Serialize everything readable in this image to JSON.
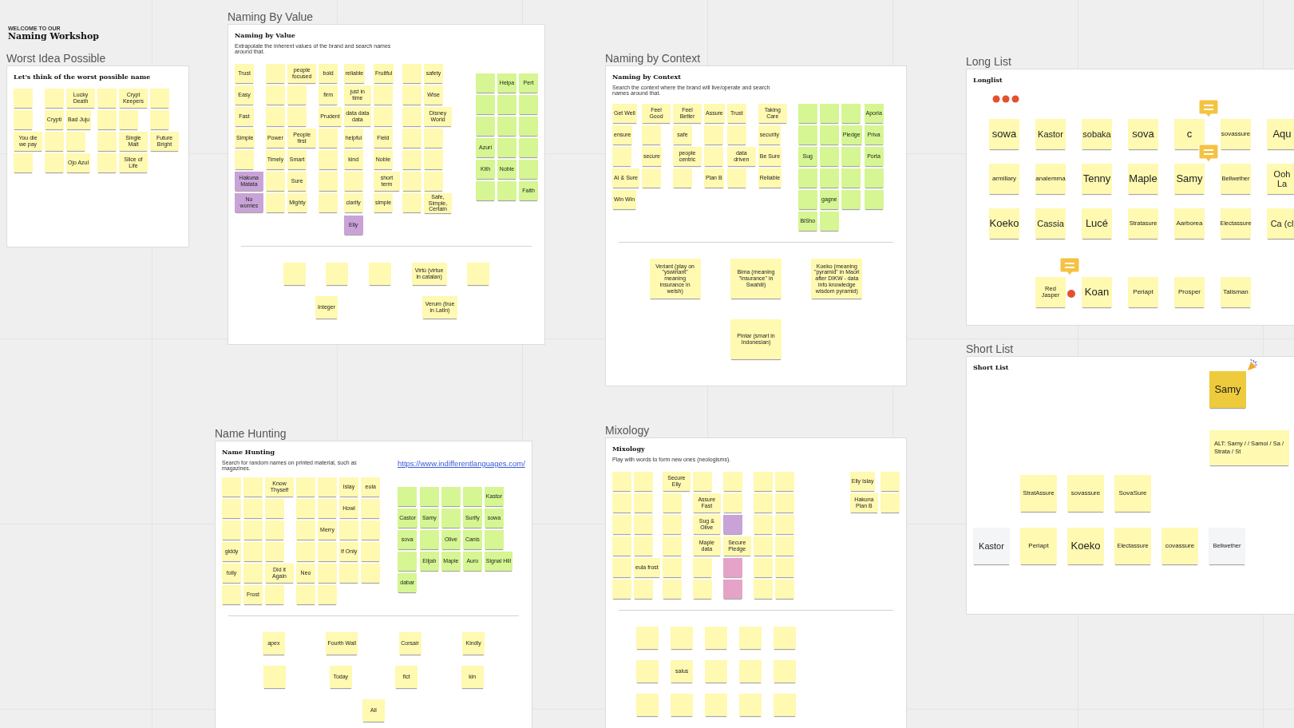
{
  "header": {
    "kicker": "WELCOME TO OUR",
    "title": "Naming Workshop"
  },
  "frames": [
    {
      "kind": "workshop",
      "label": "Worst Idea Possible",
      "heading": "Let's think of the worst possible name",
      "clusters": [
        {
          "notes": [
            {
              "color": "#fff9b1"
            },
            {
              "color": "#fff9b1"
            },
            {
              "text": "Lucky Death",
              "color": "#fff9b1"
            },
            {
              "color": "#fff9b1"
            },
            {
              "text": "Crypt Keepers",
              "color": "#fff9b1"
            },
            {
              "color": "#fff9b1"
            },
            {
              "color": "#fff9b1"
            },
            {
              "text": "Crypti",
              "color": "#fff9b1"
            },
            {
              "text": "Bad Juju",
              "color": "#fff9b1"
            },
            {
              "color": "#fff9b1"
            },
            {
              "color": "#fff9b1"
            },
            {
              "color": "#fff9b1"
            },
            {
              "text": "You die we pay",
              "color": "#fff9b1"
            },
            {
              "color": "#fff9b1"
            },
            {
              "color": "#fff9b1"
            },
            {
              "color": "#fff9b1"
            },
            {
              "text": "Single Malt",
              "color": "#fff9b1"
            },
            {
              "text": "Future Bright",
              "color": "#fff9b1"
            },
            {
              "color": "#fff9b1"
            },
            {
              "color": "#fff9b1"
            },
            {
              "text": "Ojo Azul",
              "color": "#fff9b1"
            },
            {
              "color": "#fff9b1"
            },
            {
              "text": "Slice of Life",
              "color": "#fff9b1"
            }
          ]
        }
      ]
    },
    {
      "kind": "workshop",
      "label": "Naming By Value",
      "heading": "Naming by Value",
      "description": "Extrapolate the inherent values of the brand and search names around that.",
      "clusters": [
        {
          "notes": [
            {
              "text": "Trust",
              "color": "#fff9b1"
            },
            {
              "color": "#fff9b1"
            },
            {
              "text": "people focused",
              "color": "#fff9b1"
            },
            {
              "text": "bold",
              "color": "#fff9b1"
            },
            {
              "text": "reliable",
              "color": "#fff9b1"
            },
            {
              "text": "Fruitful",
              "color": "#fff9b1"
            },
            {
              "color": "#fff9b1"
            },
            {
              "text": "safety",
              "color": "#fff9b1"
            },
            {
              "text": "Easy",
              "color": "#fff9b1"
            },
            {
              "color": "#fff9b1"
            },
            {
              "color": "#fff9b1"
            },
            {
              "text": "firm",
              "color": "#fff9b1"
            },
            {
              "text": "just in time",
              "color": "#fff9b1"
            },
            {
              "color": "#fff9b1"
            },
            {
              "color": "#fff9b1"
            },
            {
              "text": "Wise",
              "color": "#fff9b1"
            },
            {
              "text": "Fast",
              "color": "#fff9b1"
            },
            {
              "color": "#fff9b1"
            },
            {
              "color": "#fff9b1"
            },
            {
              "text": "Prudent",
              "color": "#fff9b1"
            },
            {
              "text": "data data data",
              "color": "#fff9b1"
            },
            {
              "color": "#fff9b1"
            },
            {
              "color": "#fff9b1"
            },
            {
              "text": "Disney World",
              "color": "#fff9b1"
            },
            {
              "text": "Simple",
              "color": "#fff9b1"
            },
            {
              "text": "Power",
              "color": "#fff9b1"
            },
            {
              "text": "People first",
              "color": "#fff9b1"
            },
            {
              "color": "#fff9b1"
            },
            {
              "text": "helpful",
              "color": "#fff9b1"
            },
            {
              "text": "Field",
              "color": "#fff9b1"
            },
            {
              "color": "#fff9b1"
            },
            {
              "color": "#fff9b1"
            },
            {
              "color": "#fff9b1"
            },
            {
              "text": "Timely",
              "color": "#fff9b1"
            },
            {
              "text": "Smart",
              "color": "#fff9b1"
            },
            {
              "color": "#fff9b1"
            },
            {
              "text": "kind",
              "color": "#fff9b1"
            },
            {
              "text": "Noble",
              "color": "#fff9b1"
            },
            {
              "color": "#fff9b1"
            },
            {
              "color": "#fff9b1"
            },
            {
              "text": "Hakuna Matata",
              "color": "#c9a3d8"
            },
            {
              "color": "#fff9b1"
            },
            {
              "text": "Sure",
              "color": "#fff9b1"
            },
            {
              "color": "#fff9b1"
            },
            {
              "color": "#fff9b1"
            },
            {
              "text": "short term",
              "color": "#fff9b1"
            },
            {
              "color": "#fff9b1"
            },
            {
              "color": "#fff9b1"
            },
            {
              "text": "No worries",
              "color": "#c9a3d8"
            },
            {
              "color": "#fff9b1"
            },
            {
              "text": "Mighty",
              "color": "#fff9b1"
            },
            {
              "color": "#fff9b1"
            },
            {
              "text": "clarity",
              "color": "#fff9b1"
            },
            {
              "text": "simple",
              "color": "#fff9b1"
            },
            {
              "color": "#fff9b1"
            },
            {
              "text": "Safe, Simple, Certain",
              "color": "#fff9b1"
            },
            {
              "text": "Elly",
              "color": "#c9a3d8"
            }
          ]
        },
        {
          "notes": [
            {
              "color": "#d5f692"
            },
            {
              "text": "Helpa",
              "color": "#d5f692"
            },
            {
              "text": "Pert",
              "color": "#d5f692"
            },
            {
              "color": "#d5f692"
            },
            {
              "color": "#d5f692"
            },
            {
              "color": "#d5f692"
            },
            {
              "color": "#d5f692"
            },
            {
              "color": "#d5f692"
            },
            {
              "color": "#d5f692"
            },
            {
              "text": "Azuri",
              "color": "#d5f692"
            },
            {
              "color": "#d5f692"
            },
            {
              "color": "#d5f692"
            },
            {
              "text": "Kith",
              "color": "#d5f692"
            },
            {
              "text": "Noble",
              "color": "#d5f692"
            },
            {
              "color": "#d5f692"
            },
            {
              "color": "#d5f692"
            },
            {
              "color": "#d5f692"
            },
            {
              "text": "Faith",
              "color": "#d5f692"
            }
          ]
        }
      ],
      "lower": [
        {
          "notes": [
            {
              "color": "#fff9b1"
            },
            {
              "color": "#fff9b1"
            },
            {
              "color": "#fff9b1"
            },
            {
              "text": "Virtù (virtue in catalan)",
              "color": "#fff9b1"
            },
            {
              "color": "#fff9b1"
            },
            {
              "text": "Integer",
              "color": "#fff9b1"
            },
            {
              "text": "Verum (true in Latin)",
              "color": "#fff9b1"
            }
          ]
        }
      ]
    },
    {
      "kind": "workshop",
      "label": "Naming by Context",
      "heading": "Naming by Context",
      "description": "Search the context where the brand will live/operate and search names around that.",
      "clusters": [
        {
          "notes": [
            {
              "text": "Get Well",
              "color": "#fff9b1"
            },
            {
              "text": "Feel Good",
              "color": "#fff9b1"
            },
            {
              "text": "Feel Better",
              "color": "#fff9b1"
            },
            {
              "text": "Assure",
              "color": "#fff9b1"
            },
            {
              "text": "Trust",
              "color": "#fff9b1"
            },
            {
              "text": "Taking Care",
              "color": "#fff9b1"
            },
            {
              "text": "ensure",
              "color": "#fff9b1"
            },
            {
              "color": "#fff9b1"
            },
            {
              "text": "safe",
              "color": "#fff9b1"
            },
            {
              "color": "#fff9b1"
            },
            {
              "color": "#fff9b1"
            },
            {
              "text": "security",
              "color": "#fff9b1"
            },
            {
              "color": "#fff9b1"
            },
            {
              "text": "secure",
              "color": "#fff9b1"
            },
            {
              "text": "people centric",
              "color": "#fff9b1"
            },
            {
              "color": "#fff9b1"
            },
            {
              "text": "data driven",
              "color": "#fff9b1"
            },
            {
              "text": "Be Sure",
              "color": "#fff9b1"
            },
            {
              "text": "AI & Sure",
              "color": "#fff9b1"
            },
            {
              "color": "#fff9b1"
            },
            {
              "color": "#fff9b1"
            },
            {
              "text": "Plan B",
              "color": "#fff9b1"
            },
            {
              "color": "#fff9b1"
            },
            {
              "text": "Reliable",
              "color": "#fff9b1"
            },
            {
              "text": "Win Win",
              "color": "#fff9b1"
            }
          ]
        },
        {
          "notes": [
            {
              "color": "#d5f692"
            },
            {
              "color": "#d5f692"
            },
            {
              "color": "#d5f692"
            },
            {
              "text": "Aporia",
              "color": "#d5f692"
            },
            {
              "color": "#d5f692"
            },
            {
              "color": "#d5f692"
            },
            {
              "text": "Pledge",
              "color": "#d5f692"
            },
            {
              "text": "Priva",
              "color": "#d5f692"
            },
            {
              "text": "Sug",
              "color": "#d5f692"
            },
            {
              "color": "#d5f692"
            },
            {
              "color": "#d5f692"
            },
            {
              "text": "Porta",
              "color": "#d5f692"
            },
            {
              "color": "#d5f692"
            },
            {
              "color": "#d5f692"
            },
            {
              "color": "#d5f692"
            },
            {
              "color": "#d5f692"
            },
            {
              "color": "#d5f692"
            },
            {
              "text": "gagne",
              "color": "#d5f692"
            },
            {
              "color": "#d5f692"
            },
            {
              "color": "#d5f692"
            },
            {
              "text": "BiSho",
              "color": "#d5f692"
            },
            {
              "color": "#d5f692"
            }
          ]
        }
      ],
      "lower": [
        {
          "notes": [
            {
              "text": "Veriant (play on \"yswiriant\" meaning insurance in welsh)",
              "color": "#fff9b1"
            },
            {
              "text": "Bima (meaning \"insurance\" in Swahili)",
              "color": "#fff9b1"
            },
            {
              "text": "Koeko (meaning \"pyramid\" in Maori after DIKW - data info knowledge wisdom pyramid)",
              "color": "#fff9b1"
            },
            {
              "text": "Pintar (smart in Indonesian)",
              "color": "#fff9b1"
            }
          ]
        }
      ]
    },
    {
      "kind": "list",
      "label": "Long List",
      "heading": "Longlist",
      "clusters": [
        {
          "notes": [
            {
              "text": "sowa",
              "color": "#fff9b1"
            },
            {
              "text": "Kastor",
              "color": "#fff9b1"
            },
            {
              "text": "sobaka",
              "color": "#fff9b1"
            },
            {
              "text": "sova",
              "color": "#fff9b1"
            },
            {
              "text": "c",
              "color": "#fff9b1",
              "kind": "commented"
            },
            {
              "text": "sovassure",
              "color": "#fff9b1"
            },
            {
              "text": "Aqu",
              "color": "#fff9b1"
            },
            {
              "text": "armillary",
              "color": "#fff9b1"
            },
            {
              "text": "analemma",
              "color": "#fff9b1"
            },
            {
              "text": "Tenny",
              "color": "#fff9b1"
            },
            {
              "text": "Maple",
              "color": "#fff9b1"
            },
            {
              "text": "Samy",
              "color": "#fff9b1",
              "kind": "commented"
            },
            {
              "text": "Bellwether",
              "color": "#fff9b1"
            },
            {
              "text": "Ooh La",
              "color": "#fff9b1"
            },
            {
              "text": "Koeko",
              "color": "#fff9b1"
            },
            {
              "text": "Cassia",
              "color": "#fff9b1"
            },
            {
              "text": "Lucé",
              "color": "#fff9b1"
            },
            {
              "text": "Stratasure",
              "color": "#fff9b1"
            },
            {
              "text": "Aarborea",
              "color": "#fff9b1"
            },
            {
              "text": "Electassure",
              "color": "#fff9b1"
            },
            {
              "text": "Ca (cl",
              "color": "#fff9b1"
            },
            {
              "text": "Red Jasper",
              "color": "#fff9b1",
              "kind": "commented-pinned"
            },
            {
              "text": "Koan",
              "color": "#fff9b1"
            },
            {
              "text": "Periapt",
              "color": "#fff9b1"
            },
            {
              "text": "Prosper",
              "color": "#fff9b1"
            },
            {
              "text": "Talisman",
              "color": "#fff9b1"
            }
          ]
        }
      ]
    },
    {
      "kind": "list",
      "label": "Short List",
      "heading": "Short List",
      "clusters": [
        {
          "notes": [
            {
              "text": "Samy",
              "color": "#eecb3c",
              "kind": "celebrated"
            },
            {
              "text": "ALT: Samy / / Samoi / Sa / Strata / St",
              "color": "#fff9b1"
            }
          ]
        },
        {
          "notes": [
            {
              "text": "StratAssure",
              "color": "#fff9b1"
            },
            {
              "text": "sovassure",
              "color": "#fff9b1"
            },
            {
              "text": "SovaSure",
              "color": "#fff9b1"
            },
            {
              "text": "Kastor",
              "color": "#f4f5f7"
            },
            {
              "text": "Periapt",
              "color": "#fff9b1"
            },
            {
              "text": "Koeko",
              "color": "#fff9b1"
            },
            {
              "text": "Electassure",
              "color": "#fff9b1"
            },
            {
              "text": "covassure",
              "color": "#fff9b1"
            },
            {
              "text": "Bellwether",
              "color": "#f4f5f7"
            }
          ]
        }
      ]
    },
    {
      "kind": "workshop",
      "label": "Name Hunting",
      "heading": "Name Hunting",
      "description": "Search for random names on printed material, such as magazines.",
      "link": "https://www.indifferentlanguages.com/",
      "clusters": [
        {
          "notes": [
            {
              "color": "#fff9b1"
            },
            {
              "color": "#fff9b1"
            },
            {
              "text": "Know Thyself",
              "color": "#fff9b1"
            },
            {
              "color": "#fff9b1"
            },
            {
              "color": "#fff9b1"
            },
            {
              "text": "Islay",
              "color": "#fff9b1"
            },
            {
              "text": "eula",
              "color": "#fff9b1"
            },
            {
              "color": "#fff9b1"
            },
            {
              "color": "#fff9b1"
            },
            {
              "color": "#fff9b1"
            },
            {
              "color": "#fff9b1"
            },
            {
              "color": "#fff9b1"
            },
            {
              "text": "Howl",
              "color": "#fff9b1"
            },
            {
              "color": "#fff9b1"
            },
            {
              "color": "#fff9b1"
            },
            {
              "color": "#fff9b1"
            },
            {
              "color": "#fff9b1"
            },
            {
              "color": "#fff9b1"
            },
            {
              "text": "Merry",
              "color": "#fff9b1"
            },
            {
              "color": "#fff9b1"
            },
            {
              "color": "#fff9b1"
            },
            {
              "text": "giddy",
              "color": "#fff9b1"
            },
            {
              "color": "#fff9b1"
            },
            {
              "color": "#fff9b1"
            },
            {
              "color": "#fff9b1"
            },
            {
              "color": "#fff9b1"
            },
            {
              "text": "If Only",
              "color": "#fff9b1"
            },
            {
              "color": "#fff9b1"
            },
            {
              "text": "folly",
              "color": "#fff9b1"
            },
            {
              "color": "#fff9b1"
            },
            {
              "text": "Did it Again",
              "color": "#fff9b1"
            },
            {
              "text": "Neo",
              "color": "#fff9b1"
            },
            {
              "color": "#fff9b1"
            },
            {
              "color": "#fff9b1"
            },
            {
              "color": "#fff9b1"
            },
            {
              "color": "#fff9b1"
            },
            {
              "text": "Frost",
              "color": "#fff9b1"
            },
            {
              "color": "#fff9b1"
            },
            {
              "color": "#fff9b1"
            },
            {
              "color": "#fff9b1"
            }
          ]
        },
        {
          "notes": [
            {
              "color": "#d5f692"
            },
            {
              "color": "#d5f692"
            },
            {
              "color": "#d5f692"
            },
            {
              "color": "#d5f692"
            },
            {
              "text": "Kastor",
              "color": "#d5f692"
            },
            {
              "text": "Castor",
              "color": "#d5f692"
            },
            {
              "text": "Samy",
              "color": "#d5f692"
            },
            {
              "color": "#d5f692"
            },
            {
              "text": "Surify",
              "color": "#d5f692"
            },
            {
              "text": "sowa",
              "color": "#d5f692"
            },
            {
              "text": "sova",
              "color": "#d5f692"
            },
            {
              "color": "#d5f692"
            },
            {
              "text": "Olive",
              "color": "#d5f692"
            },
            {
              "text": "Canis",
              "color": "#d5f692"
            },
            {
              "color": "#d5f692"
            },
            {
              "color": "#d5f692"
            },
            {
              "text": "Elijah",
              "color": "#d5f692"
            },
            {
              "text": "Maple",
              "color": "#d5f692"
            },
            {
              "text": "Auro",
              "color": "#d5f692"
            },
            {
              "text": "Signal Hill",
              "color": "#d5f692"
            },
            {
              "text": "dabar",
              "color": "#d5f692"
            }
          ]
        }
      ],
      "lower": [
        {
          "notes": [
            {
              "text": "apex",
              "color": "#fff9b1"
            },
            {
              "text": "Fourth Wall",
              "color": "#fff9b1"
            },
            {
              "text": "Corsair",
              "color": "#fff9b1"
            },
            {
              "text": "Kindly",
              "color": "#fff9b1"
            },
            {
              "color": "#fff9b1"
            },
            {
              "text": "Today",
              "color": "#fff9b1"
            },
            {
              "text": "fict",
              "color": "#fff9b1"
            },
            {
              "text": "kin",
              "color": "#fff9b1"
            },
            {
              "text": "All",
              "color": "#fff9b1"
            }
          ]
        }
      ]
    },
    {
      "kind": "workshop",
      "label": "Mixology",
      "heading": "Mixology",
      "description": "Play with words to form new ones (neologisms).",
      "clusters": [
        {
          "notes": [
            {
              "color": "#fff9b1"
            },
            {
              "color": "#fff9b1"
            },
            {
              "text": "Secure Elly",
              "color": "#fff9b1"
            },
            {
              "color": "#fff9b1"
            },
            {
              "color": "#fff9b1"
            },
            {
              "color": "#fff9b1"
            },
            {
              "color": "#fff9b1"
            },
            {
              "color": "#fff9b1"
            },
            {
              "color": "#fff9b1"
            },
            {
              "color": "#fff9b1"
            },
            {
              "text": "Assure Fast",
              "color": "#fff9b1"
            },
            {
              "color": "#fff9b1"
            },
            {
              "color": "#fff9b1"
            },
            {
              "color": "#fff9b1"
            },
            {
              "color": "#fff9b1"
            },
            {
              "color": "#fff9b1"
            },
            {
              "color": "#fff9b1"
            },
            {
              "text": "Sug & Olive",
              "color": "#fff9b1"
            },
            {
              "color": "#c9a3d8"
            },
            {
              "color": "#fff9b1"
            },
            {
              "color": "#fff9b1"
            },
            {
              "color": "#fff9b1"
            },
            {
              "color": "#fff9b1"
            },
            {
              "color": "#fff9b1"
            },
            {
              "text": "Maple data",
              "color": "#fff9b1"
            },
            {
              "text": "Secure Pledge",
              "color": "#fff9b1"
            },
            {
              "color": "#fff9b1"
            },
            {
              "color": "#fff9b1"
            },
            {
              "color": "#fff9b1"
            },
            {
              "text": "eula frost",
              "color": "#fff9b1"
            },
            {
              "color": "#fff9b1"
            },
            {
              "color": "#fff9b1"
            },
            {
              "color": "#e6a3c8"
            },
            {
              "color": "#fff9b1"
            },
            {
              "color": "#fff9b1"
            },
            {
              "color": "#fff9b1"
            },
            {
              "color": "#fff9b1"
            },
            {
              "color": "#fff9b1"
            },
            {
              "color": "#fff9b1"
            },
            {
              "color": "#e6a3c8"
            },
            {
              "color": "#fff9b1"
            },
            {
              "color": "#fff9b1"
            }
          ]
        },
        {
          "notes": [
            {
              "text": "Elly Islay",
              "color": "#fff9b1"
            },
            {
              "color": "#fff9b1"
            },
            {
              "text": "Hakuna Plan B",
              "color": "#fff9b1"
            },
            {
              "color": "#fff9b1"
            }
          ]
        }
      ],
      "lower": [
        {
          "notes": [
            {
              "color": "#fff9b1"
            },
            {
              "color": "#fff9b1"
            },
            {
              "color": "#fff9b1"
            },
            {
              "color": "#fff9b1"
            },
            {
              "color": "#fff9b1"
            },
            {
              "color": "#fff9b1"
            },
            {
              "text": "salus",
              "color": "#fff9b1"
            },
            {
              "color": "#fff9b1"
            },
            {
              "color": "#fff9b1"
            },
            {
              "color": "#fff9b1"
            },
            {
              "color": "#fff9b1"
            },
            {
              "color": "#fff9b1"
            },
            {
              "color": "#fff9b1"
            },
            {
              "color": "#fff9b1"
            },
            {
              "color": "#fff9b1"
            }
          ]
        }
      ]
    }
  ]
}
